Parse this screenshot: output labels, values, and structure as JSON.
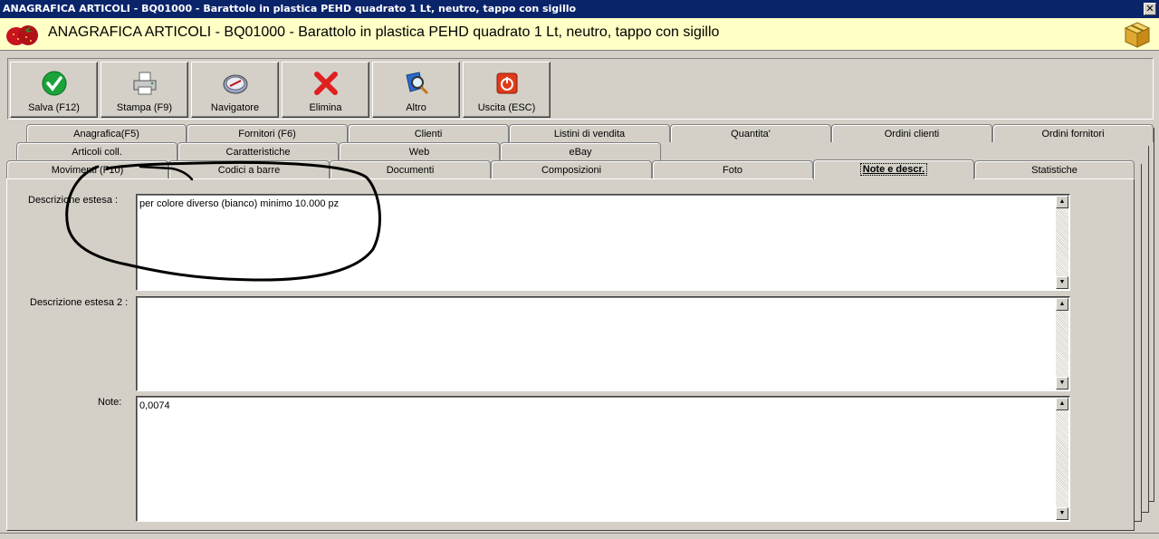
{
  "window": {
    "title": "ANAGRAFICA ARTICOLI - BQ01000 - Barattolo in plastica PEHD quadrato 1 Lt, neutro, tappo con sigillo",
    "close_glyph": "✕"
  },
  "header": {
    "title": "ANAGRAFICA ARTICOLI - BQ01000 - Barattolo in plastica PEHD quadrato 1 Lt, neutro, tappo con sigillo",
    "logo_icon": "strawberry-icon",
    "right_icon": "package-box-icon"
  },
  "toolbar": {
    "buttons": [
      {
        "label": "Salva (F12)",
        "icon": "checkmark-icon"
      },
      {
        "label": "Stampa (F9)",
        "icon": "printer-icon"
      },
      {
        "label": "Navigatore",
        "icon": "compass-icon"
      },
      {
        "label": "Elimina",
        "icon": "red-x-icon"
      },
      {
        "label": "Altro",
        "icon": "book-magnifier-icon"
      },
      {
        "label": "Uscita (ESC)",
        "icon": "power-icon"
      }
    ]
  },
  "tabs": {
    "row1": [
      "Anagrafica(F5)",
      "Fornitori (F6)",
      "Clienti",
      "Listini di vendita",
      "Quantita'",
      "Ordini clienti",
      "Ordini fornitori"
    ],
    "row2": [
      "Articoli coll.",
      "Caratteristiche",
      "Web",
      "eBay"
    ],
    "row3": [
      "Movimenti (F10)",
      "Codici a barre",
      "Documenti",
      "Composizioni",
      "Foto",
      "Note e descr.",
      "Statistiche"
    ],
    "active": "Note e descr."
  },
  "form": {
    "descrizione_estesa": {
      "label": "Descrizione estesa :",
      "value": "per colore diverso (bianco) minimo 10.000 pz"
    },
    "descrizione_estesa_2": {
      "label": "Descrizione estesa 2 :",
      "value": ""
    },
    "note": {
      "label": "Note:",
      "value": "0,0074"
    }
  },
  "colors": {
    "titlebar": "#0a246a",
    "header_bg": "#ffffc6",
    "face": "#d4d0c8"
  }
}
